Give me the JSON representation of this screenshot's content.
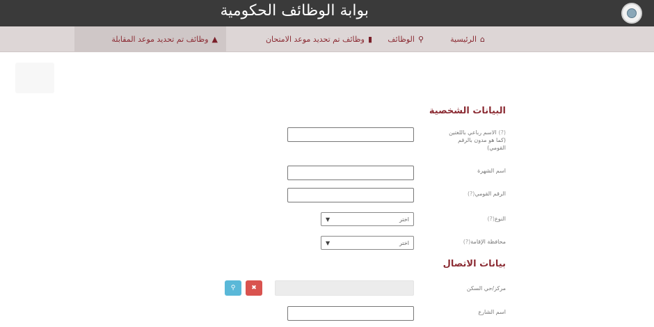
{
  "header": {
    "title": "بوابة الوظائف الحكومية"
  },
  "nav": {
    "items": [
      {
        "label": "الرئيسية",
        "icon": "home-icon",
        "glyph": "⌂"
      },
      {
        "label": "الوظائف",
        "icon": "search-icon",
        "glyph": "⚲"
      },
      {
        "label": "وظائف تم تحديد موعد الامتحان",
        "icon": "file-icon",
        "glyph": "▮"
      },
      {
        "label": "وظائف تم تحديد موعد المقابلة",
        "icon": "user-icon",
        "glyph": "▲"
      }
    ]
  },
  "personal": {
    "heading": "البيانات الشخصية",
    "full_name_label": "الاسم رباعي باللغتين (كما هو مدون بالرقم القومي)",
    "surname_label": "اسم الشهرة",
    "national_id_label": "الرقم القومي",
    "gender_label": "النوع",
    "gender_value": "اختر",
    "governorate_label": "محافظة الإقامة",
    "governorate_value": "اختر"
  },
  "contact": {
    "heading": "بيانات الاتصال",
    "postal_label": "مركز/حي السكن",
    "street_label": "اسم الشارع"
  },
  "colors": {
    "accent": "#8b2b33",
    "header_bg": "#3a3a3a",
    "nav_bg": "#ddd6d6",
    "search_btn": "#5ab8d8",
    "remove_btn": "#d9534f"
  }
}
